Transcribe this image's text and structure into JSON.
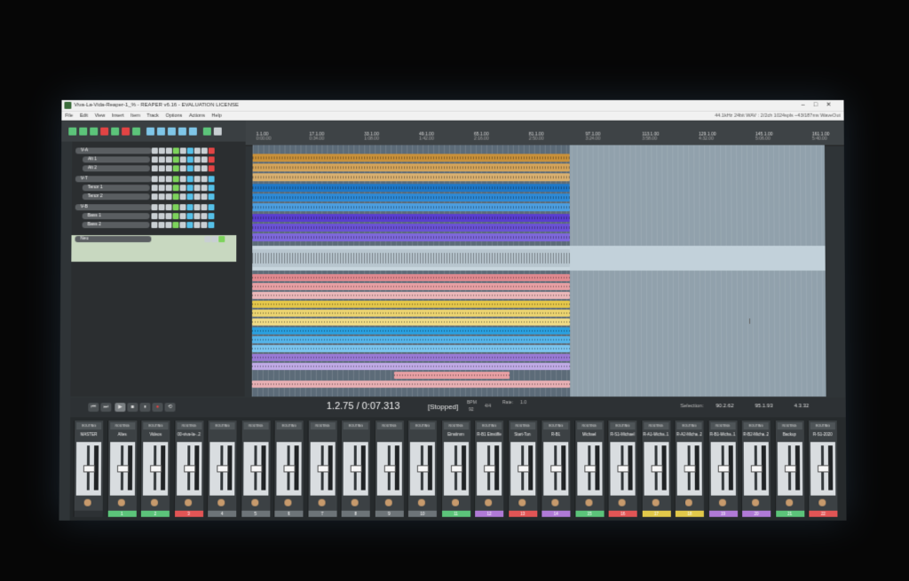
{
  "window": {
    "title": "Viva-La-Vida-Reaper-1_% - REAPER v6.16 - EVALUATION LICENSE",
    "status": "44.1kHz 24bit WAV : 2/2ch 1024spls ~43/187ms WaveOut"
  },
  "menu": [
    "File",
    "Edit",
    "View",
    "Insert",
    "Item",
    "Track",
    "Options",
    "Actions",
    "Help"
  ],
  "tracks": [
    {
      "name": "V-A",
      "color": "#c79a4a"
    },
    {
      "name": "Alt 1",
      "color": "#c79a4a"
    },
    {
      "name": "Alt 2",
      "color": "#c79a4a"
    },
    {
      "name": "V-T",
      "color": "#5aaad6"
    },
    {
      "name": "Tenor 1",
      "color": "#5aaad6"
    },
    {
      "name": "Tenor 2",
      "color": "#5aaad6"
    },
    {
      "name": "V-B",
      "color": "#9a7ad6"
    },
    {
      "name": "Bass 1",
      "color": "#9a7ad6"
    },
    {
      "name": "Bass 2",
      "color": "#9a7ad6"
    },
    {
      "name": "Neu",
      "color": "#a0d6a0"
    }
  ],
  "ruler": [
    {
      "bar": "1.1.00",
      "time": "0:00.00"
    },
    {
      "bar": "17.1.00",
      "time": "0:34.00"
    },
    {
      "bar": "33.1.00",
      "time": "1:08.00"
    },
    {
      "bar": "49.1.00",
      "time": "1:42.00"
    },
    {
      "bar": "65.1.00",
      "time": "2:16.00"
    },
    {
      "bar": "81.1.00",
      "time": "2:50.00"
    },
    {
      "bar": "97.1.00",
      "time": "3:24.00"
    },
    {
      "bar": "113.1.00",
      "time": "3:58.00"
    },
    {
      "bar": "129.1.00",
      "time": "4:32.00"
    },
    {
      "bar": "145.1.00",
      "time": "5:06.00"
    },
    {
      "bar": "161.1.00",
      "time": "5:40.00"
    }
  ],
  "transport": {
    "position": "1.2.75 / 0:07.313",
    "state": "[Stopped]",
    "bpm_label": "BPM",
    "bpm": "92",
    "time_sig": "4/4",
    "rate_label": "Rate:",
    "rate": "1.0",
    "selection_label": "Selection:",
    "selection_start": "90.2.62",
    "selection_end": "95.1.93",
    "selection_length": "4.3.32"
  },
  "mixer": {
    "route_label": "ROUTING",
    "strips": [
      {
        "name": "MASTER",
        "num": "",
        "color": "#2d3134"
      },
      {
        "name": "Altes",
        "num": "1",
        "color": "#5cc47a"
      },
      {
        "name": "Videos",
        "num": "2",
        "color": "#5cc47a"
      },
      {
        "name": "00-viva-la-..2",
        "num": "3",
        "color": "#e25555"
      },
      {
        "name": "",
        "num": "4",
        "color": "#6d7478"
      },
      {
        "name": "",
        "num": "5",
        "color": "#6d7478"
      },
      {
        "name": "",
        "num": "6",
        "color": "#6d7478"
      },
      {
        "name": "",
        "num": "7",
        "color": "#6d7478"
      },
      {
        "name": "",
        "num": "8",
        "color": "#6d7478"
      },
      {
        "name": "",
        "num": "9",
        "color": "#6d7478"
      },
      {
        "name": "",
        "num": "10",
        "color": "#6d7478"
      },
      {
        "name": "Einstimm",
        "num": "11",
        "color": "#5cc47a"
      },
      {
        "name": "R-B1 Einstiffe",
        "num": "12",
        "color": "#b07ad6"
      },
      {
        "name": "Start-Ton",
        "num": "13",
        "color": "#e25555"
      },
      {
        "name": "R-B1",
        "num": "14",
        "color": "#b07ad6"
      },
      {
        "name": "Michael",
        "num": "15",
        "color": "#5cc47a"
      },
      {
        "name": "R-S1-Michael",
        "num": "16",
        "color": "#e25555"
      },
      {
        "name": "R-A1-Micha..1",
        "num": "17",
        "color": "#e2c94a"
      },
      {
        "name": "R-A2-Micha..2",
        "num": "18",
        "color": "#e2c94a"
      },
      {
        "name": "R-B1-Micha..1",
        "num": "19",
        "color": "#b07ad6"
      },
      {
        "name": "R-B2-Micha..2",
        "num": "20",
        "color": "#b07ad6"
      },
      {
        "name": "Backup",
        "num": "21",
        "color": "#5cc47a"
      },
      {
        "name": "R-S1-2020",
        "num": "22",
        "color": "#e25555"
      }
    ]
  }
}
